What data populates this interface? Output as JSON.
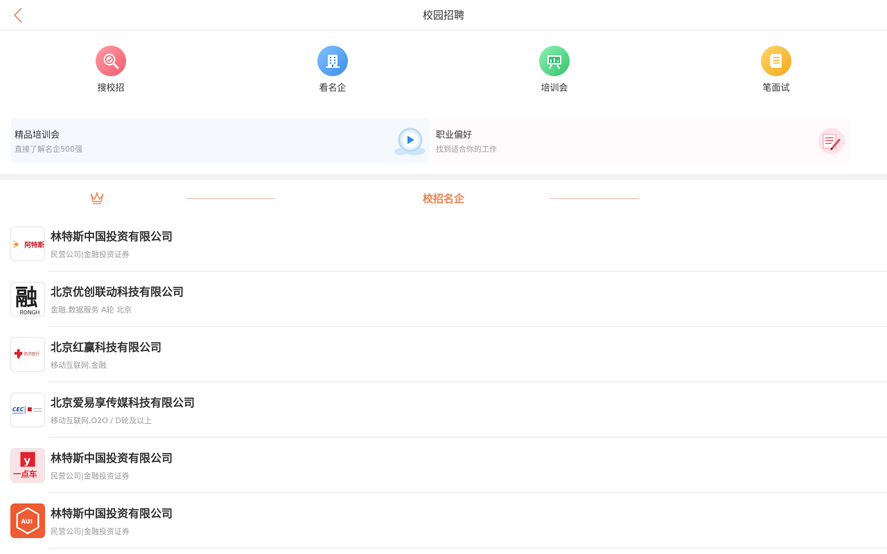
{
  "header": {
    "title": "校园招聘"
  },
  "quick_nav": [
    {
      "label": "搜校招",
      "icon": "search-campus-icon",
      "color": "#f36d7b"
    },
    {
      "label": "看名企",
      "icon": "building-icon",
      "color": "#3f95ef"
    },
    {
      "label": "培训会",
      "icon": "presentation-icon",
      "color": "#3fcf78"
    },
    {
      "label": "笔面试",
      "icon": "notebook-icon",
      "color": "#f6b21f"
    }
  ],
  "features": [
    {
      "title": "精品培训会",
      "subtitle": "直接了解名企500强",
      "icon": "video-cloud-icon",
      "bg": "#f5f9fe"
    },
    {
      "title": "职业偏好",
      "subtitle": "找到适合你的工作",
      "icon": "note-pen-icon",
      "bg": "#fffafb"
    }
  ],
  "section": {
    "title": "校招名企",
    "accent": "#f0834d"
  },
  "companies": [
    {
      "name": "林特斯中国投资有限公司",
      "tags": "民营公司|金融投资证券",
      "logo_text": "阿特斯"
    },
    {
      "name": "北京优创联动科技有限公司",
      "tags": "金融,数据服务 A轮 北京",
      "logo_text": "融",
      "logo_sub": "RONGH"
    },
    {
      "name": "北京红赢科技有限公司",
      "tags": "移动互联网,金融",
      "logo_text": "尚济医疗"
    },
    {
      "name": "北京爱易享传媒科技有限公司",
      "tags": "移动互联网,O2O / D轮及以上",
      "logo_text": "CEC"
    },
    {
      "name": "林特斯中国投资有限公司",
      "tags": "民营公司|金融投资证券",
      "logo_text": "一点车"
    },
    {
      "name": "林特斯中国投资有限公司",
      "tags": "民营公司|金融投资证券",
      "logo_text": "AUI"
    }
  ]
}
